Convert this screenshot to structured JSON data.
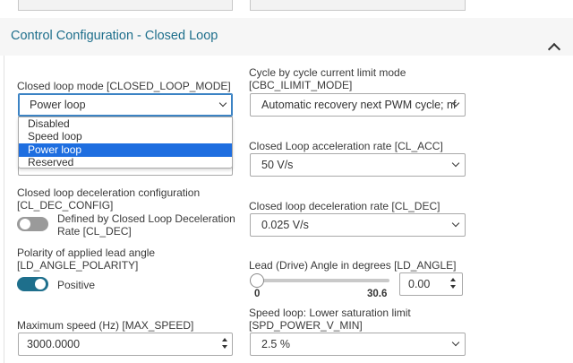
{
  "panel": {
    "title": "Control Configuration - Closed Loop"
  },
  "closed_loop_mode": {
    "label": "Closed loop mode [CLOSED_LOOP_MODE]",
    "value": "Power loop",
    "options": [
      "Disabled",
      "Speed loop",
      "Power loop",
      "Reserved"
    ]
  },
  "cbc_ilimit_mode": {
    "label_line1": "Cycle by cycle current limit mode",
    "label_line2": "[CBC_ILIMIT_MODE]",
    "value": "Automatic recovery next PWM cycle; nf"
  },
  "cl_acc": {
    "label": "Closed Loop acceleration rate [CL_ACC]",
    "value": "50 V/s"
  },
  "cl_dec_config": {
    "label_line1": "Closed loop deceleration configuration",
    "label_line2": "[CL_DEC_CONFIG]",
    "toggle_text_line1": "Defined by Closed Loop Deceleration",
    "toggle_text_line2": "Rate [CL_DEC]",
    "state": "off"
  },
  "cl_dec": {
    "label": "Closed loop deceleration rate [CL_DEC]",
    "value": "0.025 V/s"
  },
  "ld_angle_polarity": {
    "label_line1": "Polarity of applied lead angle",
    "label_line2": "[LD_ANGLE_POLARITY]",
    "toggle_text": "Positive",
    "state": "on"
  },
  "ld_angle": {
    "label": "Lead (Drive) Angle in degrees [LD_ANGLE]",
    "min": "0",
    "max": "30.6",
    "value": "0.00"
  },
  "max_speed": {
    "label": "Maximum speed (Hz) [MAX_SPEED]",
    "value": "3000.0000"
  },
  "spd_power_v_min": {
    "label_line1": "Speed loop: Lower saturation limit",
    "label_line2": "[SPD_POWER_V_MIN]",
    "value": "2.5 %"
  },
  "colors": {
    "accent": "#1e6f8c",
    "selection": "#1e6ee0",
    "focus": "#3c83c4"
  }
}
